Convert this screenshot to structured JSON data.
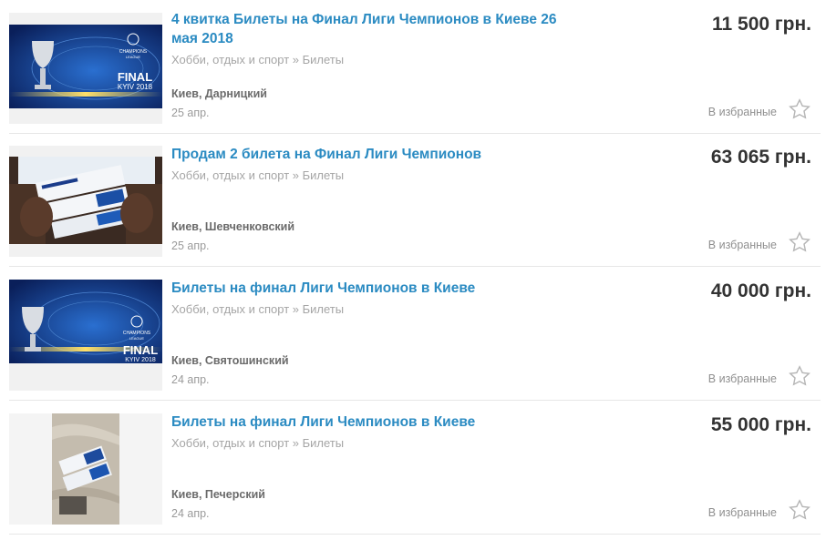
{
  "listings": [
    {
      "title": "4 квитка Билеты на Финал Лиги Чемпионов в Киеве 26 мая 2018",
      "category": "Хобби, отдых и спорт » Билеты",
      "location": "Киев, Дарницкий",
      "date": "25 апр.",
      "price": "11 500 грн.",
      "favorite_label": "В избранные",
      "image": {
        "kind": "ucl-final-banner",
        "text_top": "CHAMPIONS",
        "text_mid": "LEAGUE",
        "text_final": "FINAL",
        "text_city": "KYIV 2018"
      }
    },
    {
      "title": "Продам 2 билета на Финал Лиги Чемпионов",
      "category": "Хобби, отдых и спорт » Билеты",
      "location": "Киев, Шевченковский",
      "date": "25 апр.",
      "price": "63 065 грн.",
      "favorite_label": "В избранные",
      "image": {
        "kind": "hands-holding-tickets"
      }
    },
    {
      "title": "Билеты на финал Лиги Чемпионов в Киеве",
      "category": "Хобби, отдых и спорт » Билеты",
      "location": "Киев, Святошинский",
      "date": "24 апр.",
      "price": "40 000 грн.",
      "favorite_label": "В избранные",
      "image": {
        "kind": "ucl-final-banner",
        "text_top": "CHAMPIONS",
        "text_mid": "LEAGUE",
        "text_final": "FINAL",
        "text_city": "KYIV 2018"
      }
    },
    {
      "title": "Билеты на финал Лиги Чемпионов в Киеве",
      "category": "Хобби, отдых и спорт » Билеты",
      "location": "Киев, Печерский",
      "date": "24 апр.",
      "price": "55 000 грн.",
      "favorite_label": "В избранные",
      "image": {
        "kind": "tickets-on-fabric"
      }
    }
  ],
  "colors": {
    "title": "#2b8bc2",
    "price": "#333333",
    "muted": "#a5a5a5",
    "banner": "#0b2a6b"
  },
  "icons": {
    "favorite": "star-outline-icon"
  }
}
